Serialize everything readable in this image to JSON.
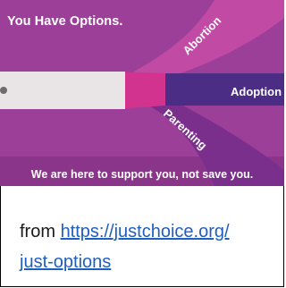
{
  "graphic": {
    "headline": "You Have Options.",
    "paths": {
      "abortion": "Abortion",
      "adoption": "Adoption",
      "parenting": "Parenting"
    },
    "support_message": "We are here to support you, not save you.",
    "colors": {
      "background": "#9c3f98",
      "abortion_band": "#c04aa4",
      "adoption_band": "#4b2d86",
      "parenting_band": "#7a2f8c",
      "road": "#e9e4e6",
      "junction": "#d2338e"
    }
  },
  "caption": {
    "prefix": "from ",
    "link_text_line1": "https://justchoice.org/",
    "link_text_line2": "just-options"
  }
}
